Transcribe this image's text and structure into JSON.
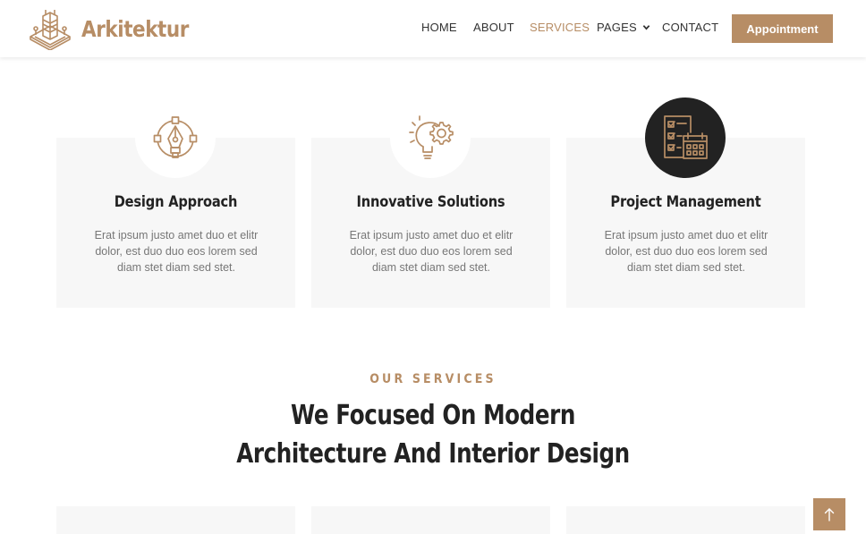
{
  "brand": {
    "name": "Arkitektur",
    "logo_icon": "building-logo-icon"
  },
  "nav": {
    "items": [
      {
        "label": "HOME",
        "active": false
      },
      {
        "label": "ABOUT",
        "active": false
      },
      {
        "label": "SERVICES",
        "active": true
      },
      {
        "label": "PAGES",
        "active": false,
        "has_dropdown": true
      },
      {
        "label": "CONTACT",
        "active": false
      }
    ],
    "cta": "Appointment"
  },
  "features": [
    {
      "icon": "pen-tool-icon",
      "title": "Design Approach",
      "text": "Erat ipsum justo amet duo et elitr dolor, est duo duo eos lorem sed diam stet diam sed stet.",
      "highlighted": false
    },
    {
      "icon": "lightbulb-gear-icon",
      "title": "Innovative Solutions",
      "text": "Erat ipsum justo amet duo et elitr dolor, est duo duo eos lorem sed diam stet diam sed stet.",
      "highlighted": false
    },
    {
      "icon": "checklist-calendar-icon",
      "title": "Project Management",
      "text": "Erat ipsum justo amet duo et elitr dolor, est duo duo eos lorem sed diam stet diam sed stet.",
      "highlighted": true
    }
  ],
  "services_section": {
    "subtitle": "OUR SERVICES",
    "title_line1": "We Focused On Modern",
    "title_line2": "Architecture And Interior Design"
  },
  "colors": {
    "accent": "#b78d65",
    "dark": "#222222",
    "card_bg": "#f7f7f7",
    "text_muted": "#777777"
  },
  "back_to_top_icon": "arrow-up-icon"
}
